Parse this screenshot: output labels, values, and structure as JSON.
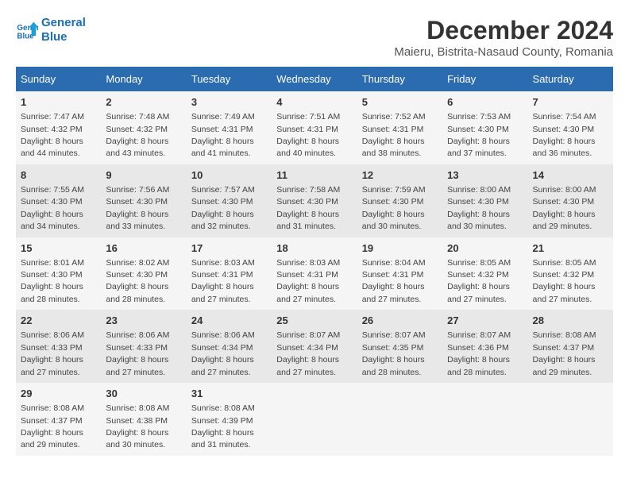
{
  "logo": {
    "line1": "General",
    "line2": "Blue"
  },
  "title": "December 2024",
  "subtitle": "Maieru, Bistrita-Nasaud County, Romania",
  "days_of_week": [
    "Sunday",
    "Monday",
    "Tuesday",
    "Wednesday",
    "Thursday",
    "Friday",
    "Saturday"
  ],
  "weeks": [
    [
      {
        "day": "1",
        "sunrise": "7:47 AM",
        "sunset": "4:32 PM",
        "daylight": "8 hours and 44 minutes."
      },
      {
        "day": "2",
        "sunrise": "7:48 AM",
        "sunset": "4:32 PM",
        "daylight": "8 hours and 43 minutes."
      },
      {
        "day": "3",
        "sunrise": "7:49 AM",
        "sunset": "4:31 PM",
        "daylight": "8 hours and 41 minutes."
      },
      {
        "day": "4",
        "sunrise": "7:51 AM",
        "sunset": "4:31 PM",
        "daylight": "8 hours and 40 minutes."
      },
      {
        "day": "5",
        "sunrise": "7:52 AM",
        "sunset": "4:31 PM",
        "daylight": "8 hours and 38 minutes."
      },
      {
        "day": "6",
        "sunrise": "7:53 AM",
        "sunset": "4:30 PM",
        "daylight": "8 hours and 37 minutes."
      },
      {
        "day": "7",
        "sunrise": "7:54 AM",
        "sunset": "4:30 PM",
        "daylight": "8 hours and 36 minutes."
      }
    ],
    [
      {
        "day": "8",
        "sunrise": "7:55 AM",
        "sunset": "4:30 PM",
        "daylight": "8 hours and 34 minutes."
      },
      {
        "day": "9",
        "sunrise": "7:56 AM",
        "sunset": "4:30 PM",
        "daylight": "8 hours and 33 minutes."
      },
      {
        "day": "10",
        "sunrise": "7:57 AM",
        "sunset": "4:30 PM",
        "daylight": "8 hours and 32 minutes."
      },
      {
        "day": "11",
        "sunrise": "7:58 AM",
        "sunset": "4:30 PM",
        "daylight": "8 hours and 31 minutes."
      },
      {
        "day": "12",
        "sunrise": "7:59 AM",
        "sunset": "4:30 PM",
        "daylight": "8 hours and 30 minutes."
      },
      {
        "day": "13",
        "sunrise": "8:00 AM",
        "sunset": "4:30 PM",
        "daylight": "8 hours and 30 minutes."
      },
      {
        "day": "14",
        "sunrise": "8:00 AM",
        "sunset": "4:30 PM",
        "daylight": "8 hours and 29 minutes."
      }
    ],
    [
      {
        "day": "15",
        "sunrise": "8:01 AM",
        "sunset": "4:30 PM",
        "daylight": "8 hours and 28 minutes."
      },
      {
        "day": "16",
        "sunrise": "8:02 AM",
        "sunset": "4:30 PM",
        "daylight": "8 hours and 28 minutes."
      },
      {
        "day": "17",
        "sunrise": "8:03 AM",
        "sunset": "4:31 PM",
        "daylight": "8 hours and 27 minutes."
      },
      {
        "day": "18",
        "sunrise": "8:03 AM",
        "sunset": "4:31 PM",
        "daylight": "8 hours and 27 minutes."
      },
      {
        "day": "19",
        "sunrise": "8:04 AM",
        "sunset": "4:31 PM",
        "daylight": "8 hours and 27 minutes."
      },
      {
        "day": "20",
        "sunrise": "8:05 AM",
        "sunset": "4:32 PM",
        "daylight": "8 hours and 27 minutes."
      },
      {
        "day": "21",
        "sunrise": "8:05 AM",
        "sunset": "4:32 PM",
        "daylight": "8 hours and 27 minutes."
      }
    ],
    [
      {
        "day": "22",
        "sunrise": "8:06 AM",
        "sunset": "4:33 PM",
        "daylight": "8 hours and 27 minutes."
      },
      {
        "day": "23",
        "sunrise": "8:06 AM",
        "sunset": "4:33 PM",
        "daylight": "8 hours and 27 minutes."
      },
      {
        "day": "24",
        "sunrise": "8:06 AM",
        "sunset": "4:34 PM",
        "daylight": "8 hours and 27 minutes."
      },
      {
        "day": "25",
        "sunrise": "8:07 AM",
        "sunset": "4:34 PM",
        "daylight": "8 hours and 27 minutes."
      },
      {
        "day": "26",
        "sunrise": "8:07 AM",
        "sunset": "4:35 PM",
        "daylight": "8 hours and 28 minutes."
      },
      {
        "day": "27",
        "sunrise": "8:07 AM",
        "sunset": "4:36 PM",
        "daylight": "8 hours and 28 minutes."
      },
      {
        "day": "28",
        "sunrise": "8:08 AM",
        "sunset": "4:37 PM",
        "daylight": "8 hours and 29 minutes."
      }
    ],
    [
      {
        "day": "29",
        "sunrise": "8:08 AM",
        "sunset": "4:37 PM",
        "daylight": "8 hours and 29 minutes."
      },
      {
        "day": "30",
        "sunrise": "8:08 AM",
        "sunset": "4:38 PM",
        "daylight": "8 hours and 30 minutes."
      },
      {
        "day": "31",
        "sunrise": "8:08 AM",
        "sunset": "4:39 PM",
        "daylight": "8 hours and 31 minutes."
      },
      null,
      null,
      null,
      null
    ]
  ],
  "label_sunrise": "Sunrise:",
  "label_sunset": "Sunset:",
  "label_daylight": "Daylight:"
}
